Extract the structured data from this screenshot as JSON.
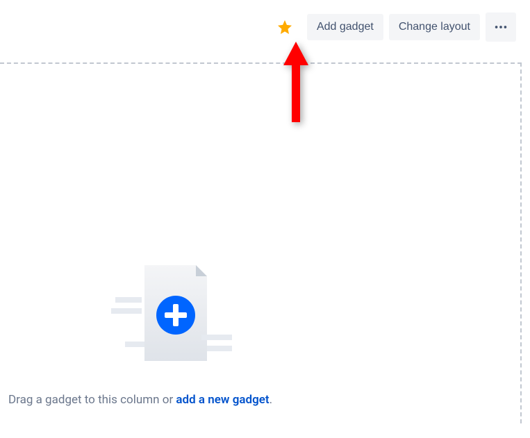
{
  "toolbar": {
    "add_gadget_label": "Add gadget",
    "change_layout_label": "Change layout"
  },
  "empty_state": {
    "drag_prefix": "Drag a gadget to this column or ",
    "link_text": "add a new gadget",
    "suffix": "."
  }
}
